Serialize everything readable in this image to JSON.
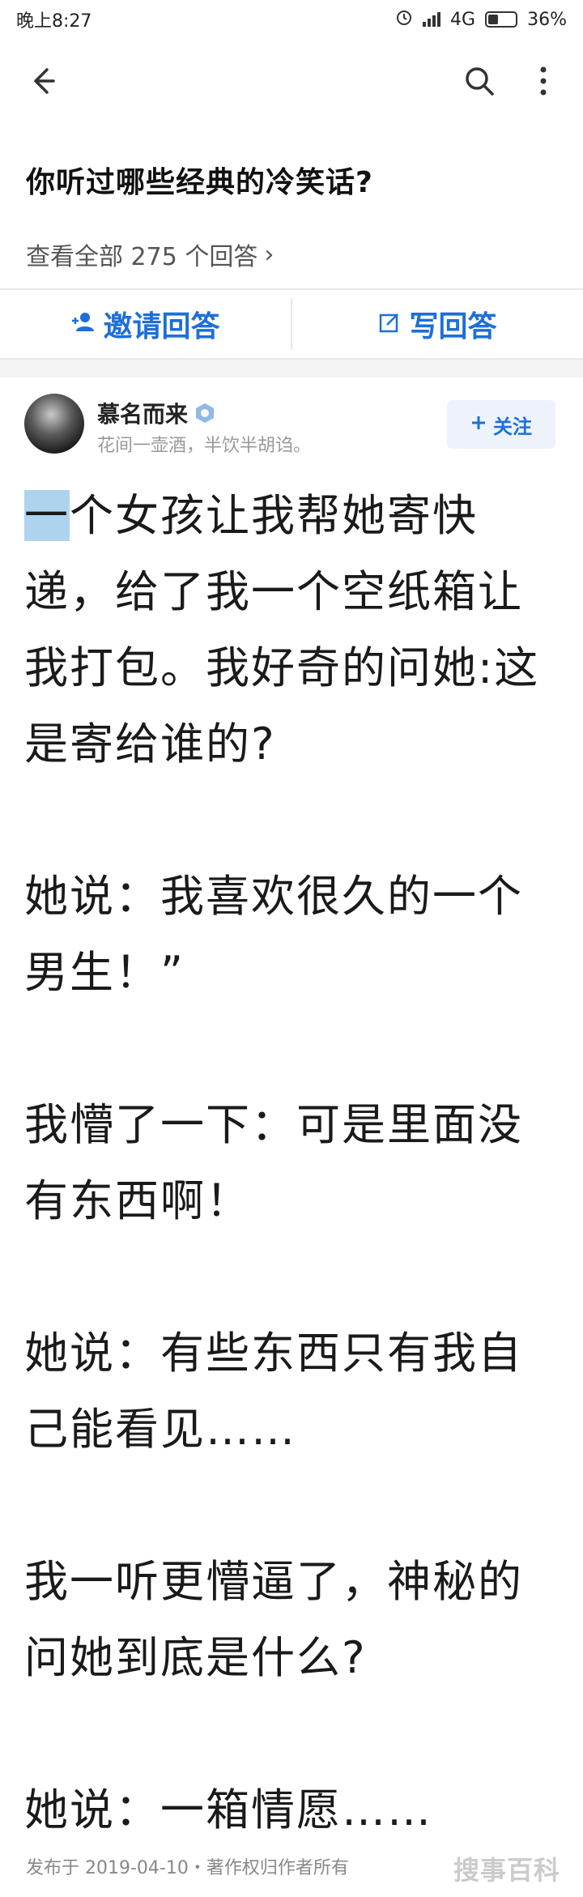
{
  "status_bar": {
    "time": "晚上8:27",
    "network": "4G",
    "battery_text": "36%",
    "battery_level": 0.36
  },
  "toolbar": {
    "back_icon": "back-arrow-icon",
    "search_icon": "search-icon",
    "more_icon": "more-vertical-icon"
  },
  "question": {
    "title": "你听过哪些经典的冷笑话?",
    "view_all": "查看全部 275 个回答",
    "view_all_chevron": "›"
  },
  "actions": {
    "invite_label": "邀请回答",
    "write_label": "写回答"
  },
  "author": {
    "name": "慕名而来",
    "bio": "花间一壶酒，半饮半胡诌。",
    "follow_label": "关注"
  },
  "answer": {
    "paragraphs": [
      [
        "一",
        "个女孩让我帮她寄快",
        "递，给了我一个空纸箱让",
        "我打包。我好奇的问她:这",
        "是寄给谁的?"
      ],
      [
        "她说：我喜欢很久的一个",
        "男生！”"
      ],
      [
        "我懵了一下：可是里面没",
        "有东西啊！"
      ],
      [
        "她说：有些东西只有我自",
        "己能看见……"
      ],
      [
        "我一听更懵逼了，神秘的",
        "问她到底是什么?"
      ],
      [
        "她说：一箱情愿……"
      ]
    ]
  },
  "footer": {
    "text": "发布于 2019-04-10・著作权归作者所有",
    "watermark": "搜事百科"
  },
  "colors": {
    "accent": "#1d6fd8",
    "highlight": "#aed3ef"
  }
}
